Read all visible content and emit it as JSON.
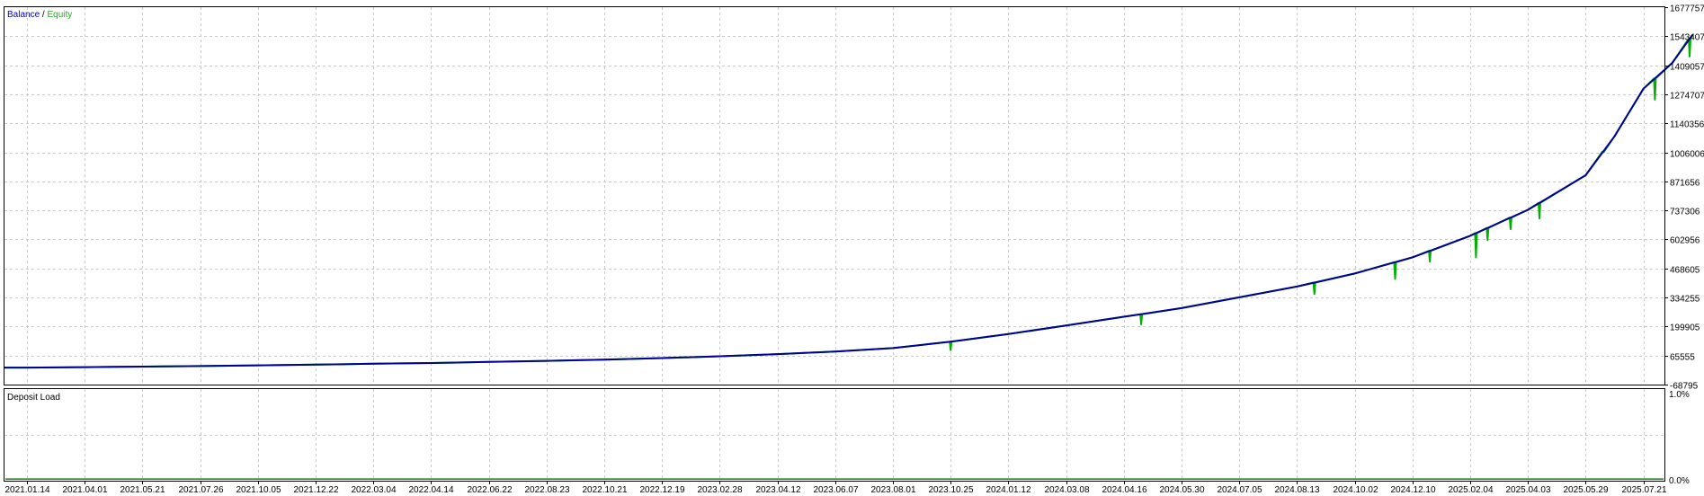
{
  "colors": {
    "background": "#ffffff",
    "frame": "#000000",
    "grid": "#c8c8c8",
    "balance_line": "#000099",
    "equity_line": "#00b000",
    "deposit_load": "#1f7a1f",
    "legend_balance": "#0000cc",
    "legend_equity": "#1fb01f"
  },
  "main_panel": {
    "legend": {
      "balance": "Balance",
      "separator": " / ",
      "equity": "Equity"
    },
    "y_tick_labels": [
      "1677757",
      "1543407",
      "1409057",
      "1274707",
      "1140356",
      "1006006",
      "871656",
      "737306",
      "602956",
      "468605",
      "334255",
      "199905",
      "65555",
      "-68795"
    ]
  },
  "deposit_panel": {
    "title": "Deposit Load",
    "y_top_label": "1.0%",
    "y_bottom_label": "0.0%"
  },
  "x_tick_labels": [
    "2021.01.14",
    "2021.04.01",
    "2021.05.21",
    "2021.07.26",
    "2021.10.05",
    "2021.12.22",
    "2022.03.04",
    "2022.04.14",
    "2022.06.22",
    "2022.08.23",
    "2022.10.21",
    "2022.12.19",
    "2023.02.28",
    "2023.04.12",
    "2023.06.07",
    "2023.08.01",
    "2023.10.25",
    "2024.01.12",
    "2024.03.08",
    "2024.04.16",
    "2024.05.30",
    "2024.07.05",
    "2024.08.13",
    "2024.10.02",
    "2024.12.10",
    "2025.02.04",
    "2025.04.03",
    "2025.05.29",
    "2025.07.21"
  ],
  "chart_data": {
    "type": "line",
    "title": "",
    "series": [
      {
        "name": "Balance",
        "color": "#000099"
      },
      {
        "name": "Equity",
        "color": "#00b000"
      }
    ],
    "x": [
      "2021.01.14",
      "2021.04.01",
      "2021.05.21",
      "2021.07.26",
      "2021.10.05",
      "2021.12.22",
      "2022.03.04",
      "2022.04.14",
      "2022.06.22",
      "2022.08.23",
      "2022.10.21",
      "2022.12.19",
      "2023.02.28",
      "2023.04.12",
      "2023.06.07",
      "2023.08.01",
      "2023.10.25",
      "2024.01.12",
      "2024.03.08",
      "2024.04.16",
      "2024.05.30",
      "2024.07.05",
      "2024.08.13",
      "2024.10.02",
      "2024.12.10",
      "2025.02.04",
      "2025.04.03",
      "2025.05.29",
      "2025.07.21"
    ],
    "balance": [
      10000,
      12000,
      14500,
      17000,
      20000,
      23500,
      27500,
      31000,
      36000,
      41000,
      47000,
      54000,
      62000,
      72000,
      84000,
      100000,
      130000,
      165000,
      205000,
      245000,
      285000,
      335000,
      385000,
      445000,
      520000,
      620000,
      740000,
      900000,
      1080000,
      1300000,
      1420000,
      1550000
    ],
    "balance_x_index": [
      0,
      1,
      2,
      3,
      4,
      5,
      6,
      7,
      8,
      9,
      10,
      11,
      12,
      13,
      14,
      15,
      16,
      17,
      18,
      19,
      20,
      21,
      22,
      23,
      24,
      25,
      26,
      27,
      27.5,
      28,
      28.5,
      28.85
    ],
    "equity_dips": [
      {
        "x_index": 16,
        "value": 90000
      },
      {
        "x_index": 19.3,
        "value": 210000
      },
      {
        "x_index": 22.3,
        "value": 350000
      },
      {
        "x_index": 23.7,
        "value": 420000
      },
      {
        "x_index": 24.3,
        "value": 500000
      },
      {
        "x_index": 25.1,
        "value": 520000
      },
      {
        "x_index": 25.3,
        "value": 600000
      },
      {
        "x_index": 25.7,
        "value": 650000
      },
      {
        "x_index": 26.2,
        "value": 700000
      },
      {
        "x_index": 27.3,
        "value": 1010000
      },
      {
        "x_index": 28.2,
        "value": 1250000
      },
      {
        "x_index": 28.8,
        "value": 1450000
      }
    ],
    "deposit_load_pct": [
      0.02,
      0.02
    ],
    "ylim": [
      -68795,
      1677757
    ],
    "deposit_ylim": [
      0,
      1
    ],
    "grid": true,
    "legend_position": "top-left"
  }
}
